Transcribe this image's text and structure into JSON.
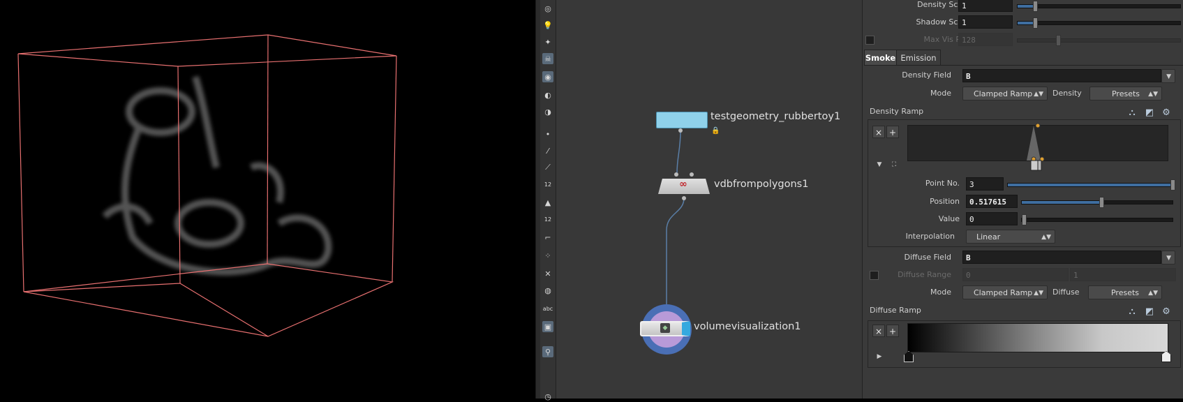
{
  "network": {
    "nodes": [
      {
        "name": "testgeometry_rubbertoy1"
      },
      {
        "name": "vdbfrompolygons1"
      },
      {
        "name": "volumevisualization1"
      }
    ]
  },
  "toolbar": {
    "points_count_label": "12",
    "prims_count_label": "12",
    "text_tool_label": "abc"
  },
  "params": {
    "density_scale": {
      "label": "Density Scale",
      "value": "1",
      "slider_fraction": 0.1
    },
    "shadow_scale": {
      "label": "Shadow Scale",
      "value": "1",
      "slider_fraction": 0.1
    },
    "max_vis_res": {
      "label": "Max Vis Res",
      "value": "128"
    },
    "tabs": [
      {
        "label": "Smoke",
        "active": true
      },
      {
        "label": "Emission",
        "active": false
      }
    ],
    "density_field": {
      "label": "Density Field",
      "value": "B"
    },
    "density_mode": {
      "label": "Mode",
      "value": "Clamped Ramp",
      "presets_label": "Density",
      "presets_value": "Presets"
    },
    "density_ramp": {
      "title": "Density Ramp",
      "point_no": {
        "label": "Point No.",
        "value": "3",
        "slider_fraction": 1.0
      },
      "position": {
        "label": "Position",
        "value": "0.517615",
        "slider_fraction": 0.517615
      },
      "value": {
        "label": "Value",
        "value": "0",
        "slider_fraction": 0.0
      },
      "interpolation": {
        "label": "Interpolation",
        "value": "Linear"
      }
    },
    "diffuse_field": {
      "label": "Diffuse Field",
      "value": "B"
    },
    "diffuse_range": {
      "label": "Diffuse Range",
      "min": "0",
      "max": "1"
    },
    "diffuse_mode": {
      "label": "Mode",
      "value": "Clamped Ramp",
      "presets_label": "Diffuse",
      "presets_value": "Presets"
    },
    "diffuse_ramp": {
      "title": "Diffuse Ramp"
    }
  },
  "colors": {
    "viewport_bg": "#000000",
    "bbox": "#e87070",
    "network_bg": "#383838",
    "slider_fill": "#3f6ea0"
  }
}
